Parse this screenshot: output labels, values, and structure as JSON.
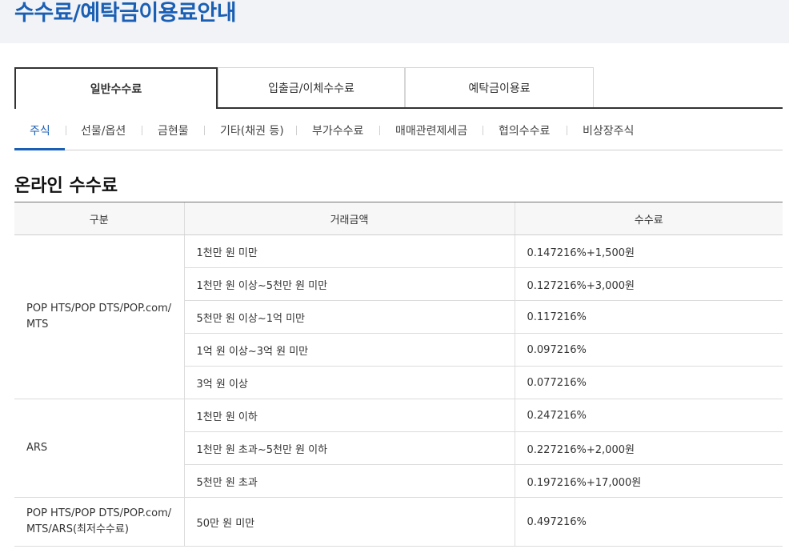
{
  "page_title": "수수료/예탁금이용료안내",
  "main_tabs": [
    "일반수수료",
    "입출금/이체수수료",
    "예탁금이용료"
  ],
  "sub_tabs": [
    "주식",
    "선물/옵션",
    "금현물",
    "기타(채권 등)",
    "부가수수료",
    "매매관련제세금",
    "협의수수료",
    "비상장주식"
  ],
  "section_title": "온라인 수수료",
  "table": {
    "headers": [
      "구분",
      "거래금액",
      "수수료"
    ],
    "groups": [
      {
        "category": "POP HTS/POP DTS/POP.com/ MTS",
        "rows": [
          {
            "amount": "1천만 원 미만",
            "fee": "0.147216%+1,500원"
          },
          {
            "amount": "1천만 원 이상~5천만 원 미만",
            "fee": "0.127216%+3,000원"
          },
          {
            "amount": "5천만 원 이상~1억 미만",
            "fee": "0.117216%"
          },
          {
            "amount": "1억 원 이상~3억 원 미만",
            "fee": "0.097216%"
          },
          {
            "amount": "3억 원 이상",
            "fee": "0.077216%"
          }
        ]
      },
      {
        "category": "ARS",
        "rows": [
          {
            "amount": "1천만 원 이하",
            "fee": "0.247216%"
          },
          {
            "amount": "1천만 원 초과~5천만 원 이하",
            "fee": "0.227216%+2,000원"
          },
          {
            "amount": "5천만 원 초과",
            "fee": "0.197216%+17,000원"
          }
        ]
      },
      {
        "category": "POP HTS/POP DTS/POP.com/ MTS/ARS(최저수수료)",
        "rows": [
          {
            "amount": "50만 원 미만",
            "fee": "0.497216%"
          }
        ]
      }
    ]
  }
}
